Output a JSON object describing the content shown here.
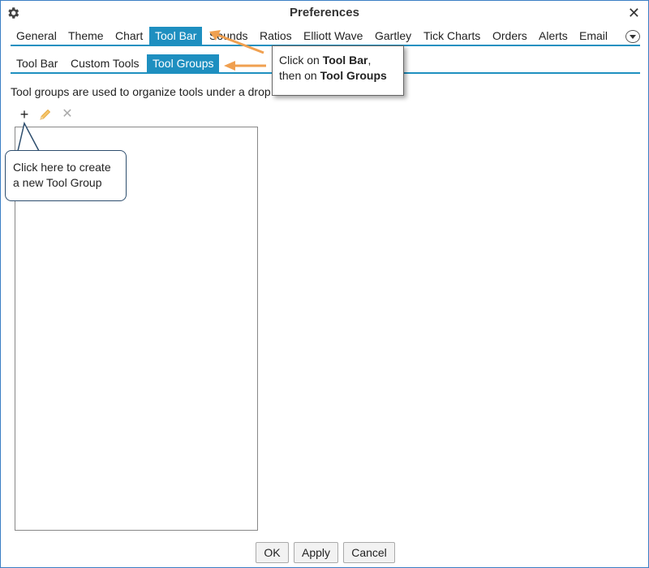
{
  "window": {
    "title": "Preferences"
  },
  "main_tabs": [
    {
      "label": "General",
      "left": 0
    },
    {
      "label": "Theme"
    },
    {
      "label": "Chart"
    },
    {
      "label": "Tool Bar",
      "active": true
    },
    {
      "label": "Sounds"
    },
    {
      "label": "Ratios"
    },
    {
      "label": "Elliott Wave"
    },
    {
      "label": "Gartley"
    },
    {
      "label": "Tick Charts"
    },
    {
      "label": "Orders"
    },
    {
      "label": "Alerts"
    },
    {
      "label": "Email"
    }
  ],
  "sub_tabs": [
    {
      "label": "Tool Bar"
    },
    {
      "label": "Custom Tools"
    },
    {
      "label": "Tool Groups",
      "active": true
    }
  ],
  "description": "Tool groups are used to organize tools under a drop",
  "buttons": {
    "ok": "OK",
    "apply": "Apply",
    "cancel": "Cancel"
  },
  "callouts": {
    "tabs_hint": {
      "prefix1": "Click on ",
      "bold1": "Tool Bar",
      "suffix1": ",",
      "prefix2": "then on ",
      "bold2": "Tool Groups"
    },
    "add_hint": {
      "line1": "Click here to create",
      "line2": "a new Tool Group"
    }
  },
  "colors": {
    "accent": "#1e8fc0",
    "arrow": "#f0a050"
  }
}
